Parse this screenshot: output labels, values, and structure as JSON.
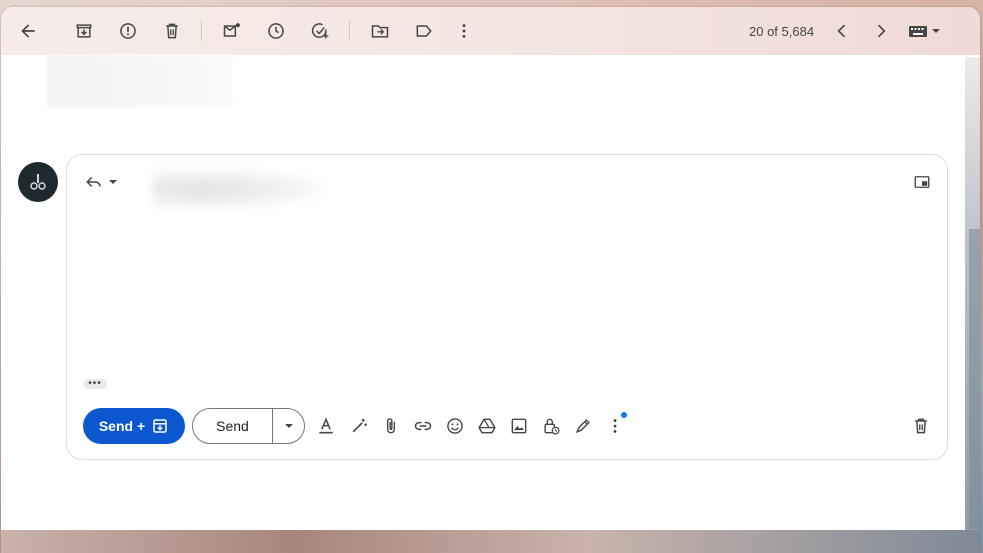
{
  "toolbar": {
    "counter": "20 of 5,684"
  },
  "compose": {
    "send_archive_label": "Send +",
    "send_label": "Send",
    "quoted_label": "•••"
  },
  "colors": {
    "send_button_bg": "#0b57d0",
    "icon": "#444746",
    "notification_dot": "#1a73e8"
  },
  "icons": [
    "back-arrow-icon",
    "archive-icon",
    "report-spam-icon",
    "delete-icon",
    "mark-unread-icon",
    "snooze-icon",
    "add-task-icon",
    "move-to-icon",
    "label-icon",
    "more-vert-icon",
    "chevron-left-icon",
    "chevron-right-icon",
    "keyboard-icon",
    "reply-icon",
    "pop-out-icon",
    "text-format-icon",
    "magic-pen-icon",
    "attach-icon",
    "link-icon",
    "emoji-icon",
    "drive-icon",
    "photo-icon",
    "confidential-icon",
    "signature-icon",
    "discard-icon"
  ]
}
